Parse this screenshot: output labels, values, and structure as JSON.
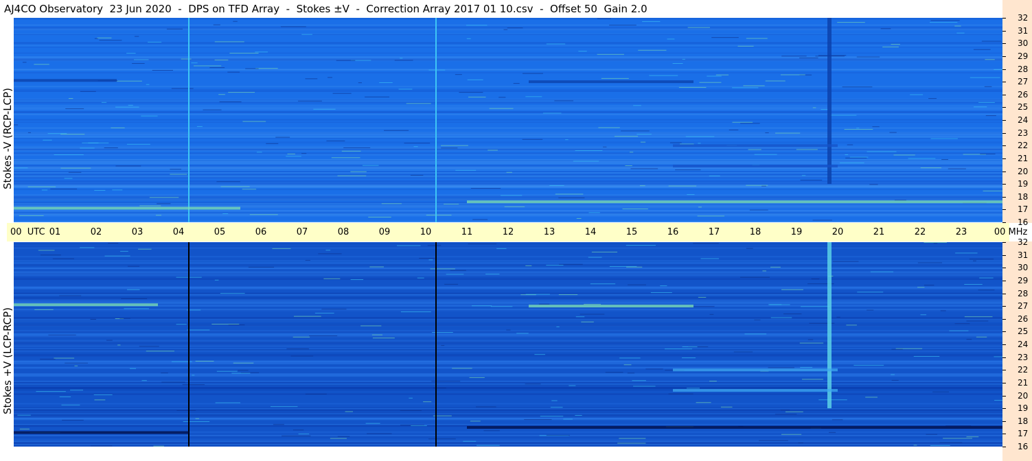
{
  "title": "AJ4CO Observatory  23 Jun 2020  -  DPS on TFD Array  -  Stokes ±V  -  Correction Array 2017 01 10.csv  -  Offset 50  Gain 2.0",
  "colors": {
    "top_panel_base": "#1a6fe8",
    "bottom_panel_base": "#1254c9",
    "time_strip": "#ffffc8",
    "right_axis": "#ffe6cf"
  },
  "chart_data": [
    {
      "type": "heatmap",
      "title": "Stokes -V (RCP-LCP)",
      "ylabel": "Stokes -V (RCP-LCP)",
      "xlabel": "UTC",
      "x_unit_label": "UTC",
      "y_unit_label": "MHz",
      "xlim": [
        0,
        24
      ],
      "ylim": [
        16,
        32
      ],
      "x_ticks": [
        "00",
        "01",
        "02",
        "03",
        "04",
        "05",
        "06",
        "07",
        "08",
        "09",
        "10",
        "11",
        "12",
        "13",
        "14",
        "15",
        "16",
        "17",
        "18",
        "19",
        "20",
        "21",
        "22",
        "23",
        "00"
      ],
      "y_ticks": [
        16,
        17,
        18,
        19,
        20,
        21,
        22,
        23,
        24,
        25,
        26,
        27,
        28,
        29,
        30,
        31,
        32
      ],
      "features": [
        {
          "kind": "vertical-line",
          "x": 4.25,
          "color": "#3ec6f5"
        },
        {
          "kind": "vertical-line",
          "x": 10.25,
          "color": "#3ec6f5"
        },
        {
          "kind": "vertical-band",
          "x": 19.8,
          "y_range": [
            19,
            32
          ],
          "color": "#0b3fa8"
        },
        {
          "kind": "horizontal-band",
          "x_range": [
            0,
            5.5
          ],
          "y": 17.1,
          "color": "#7fe0b0"
        },
        {
          "kind": "horizontal-band",
          "x_range": [
            0,
            2.5
          ],
          "y": 27.1,
          "color": "#0b3fa8"
        },
        {
          "kind": "horizontal-band",
          "x_range": [
            12.5,
            16.5
          ],
          "y": 27.0,
          "color": "#0b3fa8"
        },
        {
          "kind": "horizontal-band",
          "x_range": [
            11,
            24
          ],
          "y": 17.6,
          "color": "#7fe0b0"
        },
        {
          "kind": "horizontal-band",
          "x_range": [
            16,
            20
          ],
          "y": 22.0,
          "color": "#1553c8"
        },
        {
          "kind": "horizontal-band",
          "x_range": [
            16,
            20
          ],
          "y": 20.4,
          "color": "#1553c8"
        }
      ]
    },
    {
      "type": "heatmap",
      "title": "Stokes +V (LCP-RCP)",
      "ylabel": "Stokes +V (LCP-RCP)",
      "xlabel": "UTC",
      "x_unit_label": "UTC",
      "y_unit_label": "MHz",
      "xlim": [
        0,
        24
      ],
      "ylim": [
        16,
        32
      ],
      "x_ticks": [
        "00",
        "01",
        "02",
        "03",
        "04",
        "05",
        "06",
        "07",
        "08",
        "09",
        "10",
        "11",
        "12",
        "13",
        "14",
        "15",
        "16",
        "17",
        "18",
        "19",
        "20",
        "21",
        "22",
        "23",
        "00"
      ],
      "y_ticks": [
        16,
        17,
        18,
        19,
        20,
        21,
        22,
        23,
        24,
        25,
        26,
        27,
        28,
        29,
        30,
        31,
        32
      ],
      "features": [
        {
          "kind": "vertical-line",
          "x": 4.25,
          "color": "#000000"
        },
        {
          "kind": "vertical-line",
          "x": 10.25,
          "color": "#000000"
        },
        {
          "kind": "vertical-band",
          "x": 19.8,
          "y_range": [
            19,
            32
          ],
          "color": "#5fd8e8"
        },
        {
          "kind": "horizontal-band",
          "x_range": [
            0,
            4.25
          ],
          "y": 17.1,
          "color": "#000a40"
        },
        {
          "kind": "horizontal-band",
          "x_range": [
            0,
            3.5
          ],
          "y": 27.1,
          "color": "#7fe0b0"
        },
        {
          "kind": "horizontal-band",
          "x_range": [
            12.5,
            16.5
          ],
          "y": 27.0,
          "color": "#7fe0b0"
        },
        {
          "kind": "horizontal-band",
          "x_range": [
            11,
            24
          ],
          "y": 17.5,
          "color": "#000a40"
        },
        {
          "kind": "horizontal-band",
          "x_range": [
            16,
            20
          ],
          "y": 22.0,
          "color": "#3ea8f0"
        },
        {
          "kind": "horizontal-band",
          "x_range": [
            16,
            20
          ],
          "y": 20.4,
          "color": "#3ea8f0"
        }
      ]
    }
  ]
}
